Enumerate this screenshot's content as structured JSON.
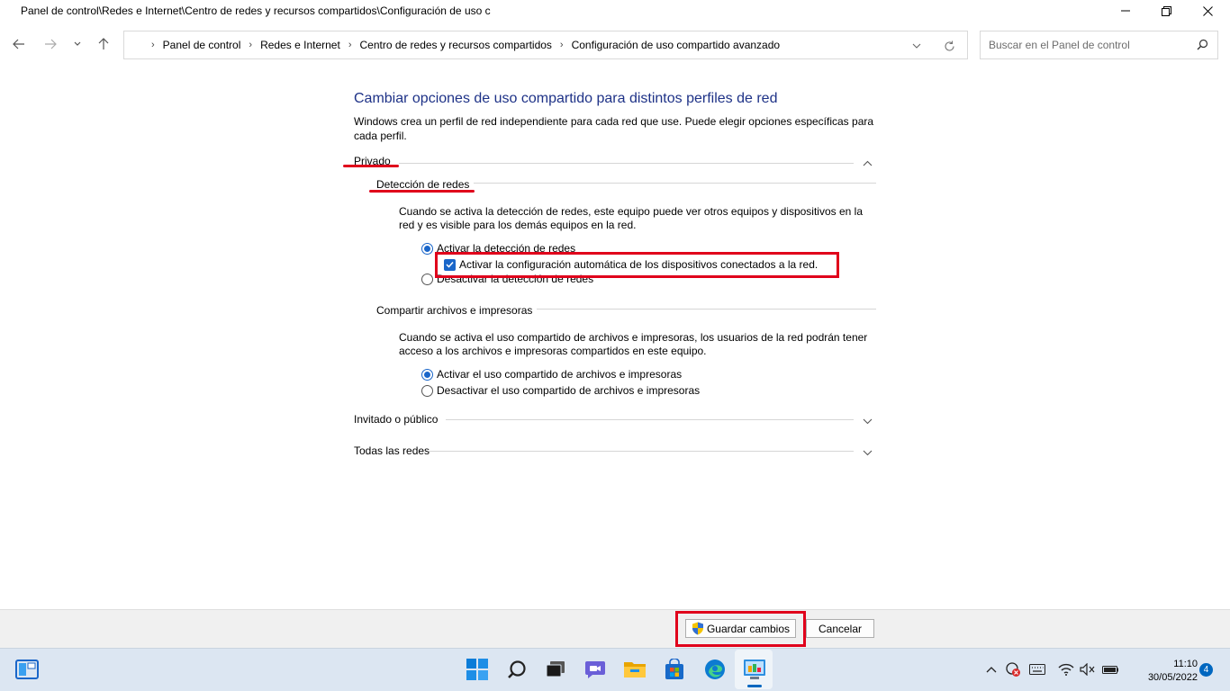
{
  "window": {
    "title": "Panel de control\\Redes e Internet\\Centro de redes y recursos compartidos\\Configuración de uso c"
  },
  "nav": {
    "breadcrumbs": [
      "Panel de control",
      "Redes e Internet",
      "Centro de redes y recursos compartidos",
      "Configuración de uso compartido avanzado"
    ],
    "search_placeholder": "Buscar en el Panel de control"
  },
  "main": {
    "heading": "Cambiar opciones de uso compartido para distintos perfiles de red",
    "description": "Windows crea un perfil de red independiente para cada red que use. Puede elegir opciones específicas para cada perfil.",
    "profiles": {
      "private": {
        "label": "Privado",
        "expanded": true,
        "network_discovery": {
          "label": "Detección de redes",
          "description": "Cuando se activa la detección de redes, este equipo puede ver otros equipos y dispositivos en la red y es visible para los demás equipos en la red.",
          "on_label": "Activar la detección de redes",
          "auto_setup_label": "Activar la configuración automática de los dispositivos conectados a la red.",
          "off_label": "Desactivar la detección de redes",
          "selected": "on",
          "auto_setup_checked": true
        },
        "file_sharing": {
          "label": "Compartir archivos e impresoras",
          "description": "Cuando se activa el uso compartido de archivos e impresoras, los usuarios de la red podrán tener acceso a los archivos e impresoras compartidos en este equipo.",
          "on_label": "Activar el uso compartido de archivos e impresoras",
          "off_label": "Desactivar el uso compartido de archivos e impresoras",
          "selected": "on"
        }
      },
      "guest": {
        "label": "Invitado o público",
        "expanded": false
      },
      "all": {
        "label": "Todas las redes",
        "expanded": false
      }
    }
  },
  "footer": {
    "save_label": "Guardar cambios",
    "cancel_label": "Cancelar"
  },
  "taskbar": {
    "time": "11:10",
    "date": "30/05/2022",
    "notification_count": "4",
    "pinned": [
      "start-icon",
      "search-icon",
      "task-view-icon",
      "chat-icon",
      "file-explorer-icon",
      "store-icon",
      "edge-icon",
      "control-panel-icon"
    ]
  },
  "colors": {
    "heading": "#1e3287",
    "accent": "#1a66c9",
    "highlight": "#e0001b",
    "taskbar": "#dce6f2"
  }
}
